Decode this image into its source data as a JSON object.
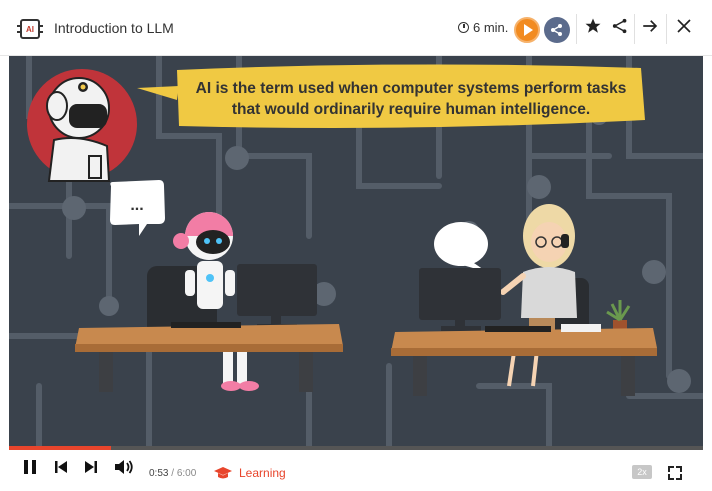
{
  "header": {
    "app_icon_text": "AI",
    "title": "Introduction to LLM",
    "duration": "6 min."
  },
  "icons": [
    "app-chip-icon",
    "clock-icon",
    "play-icon",
    "share-network-icon",
    "star-icon",
    "share-icon",
    "arrow-right-icon",
    "close-icon",
    "pause-icon",
    "skip-previous-icon",
    "skip-next-icon",
    "volume-icon",
    "graduation-cap-icon",
    "fullscreen-icon"
  ],
  "scene": {
    "speech_line1": "AI is the term used when computer systems perform tasks",
    "speech_line2": "that would ordinarily require human intelligence.",
    "robot_bubble": "..."
  },
  "player": {
    "current_time": "0:53",
    "separator": " / ",
    "total_time": "6:00",
    "progress": 0.147,
    "category": "Learning",
    "speed": "2x"
  },
  "colors": {
    "accent": "#e8452c",
    "play": "#f28b20",
    "speech_bubble": "#f0c943",
    "scene_bg": "#3a424c"
  }
}
